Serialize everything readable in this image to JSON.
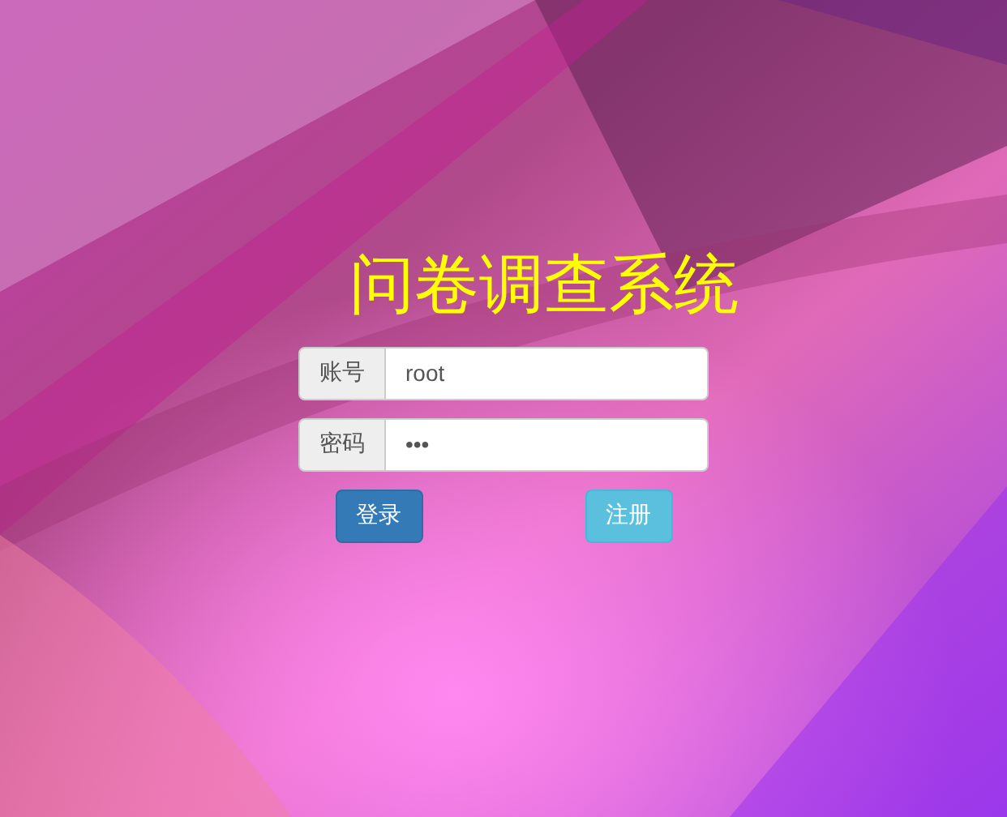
{
  "title": "问卷调查系统",
  "fields": [
    {
      "label": "账号",
      "value": "root"
    },
    {
      "label": "密码",
      "value": "•••"
    }
  ],
  "buttons": [
    {
      "label": "登录",
      "kind": "primary"
    },
    {
      "label": "注册",
      "kind": "info"
    }
  ]
}
